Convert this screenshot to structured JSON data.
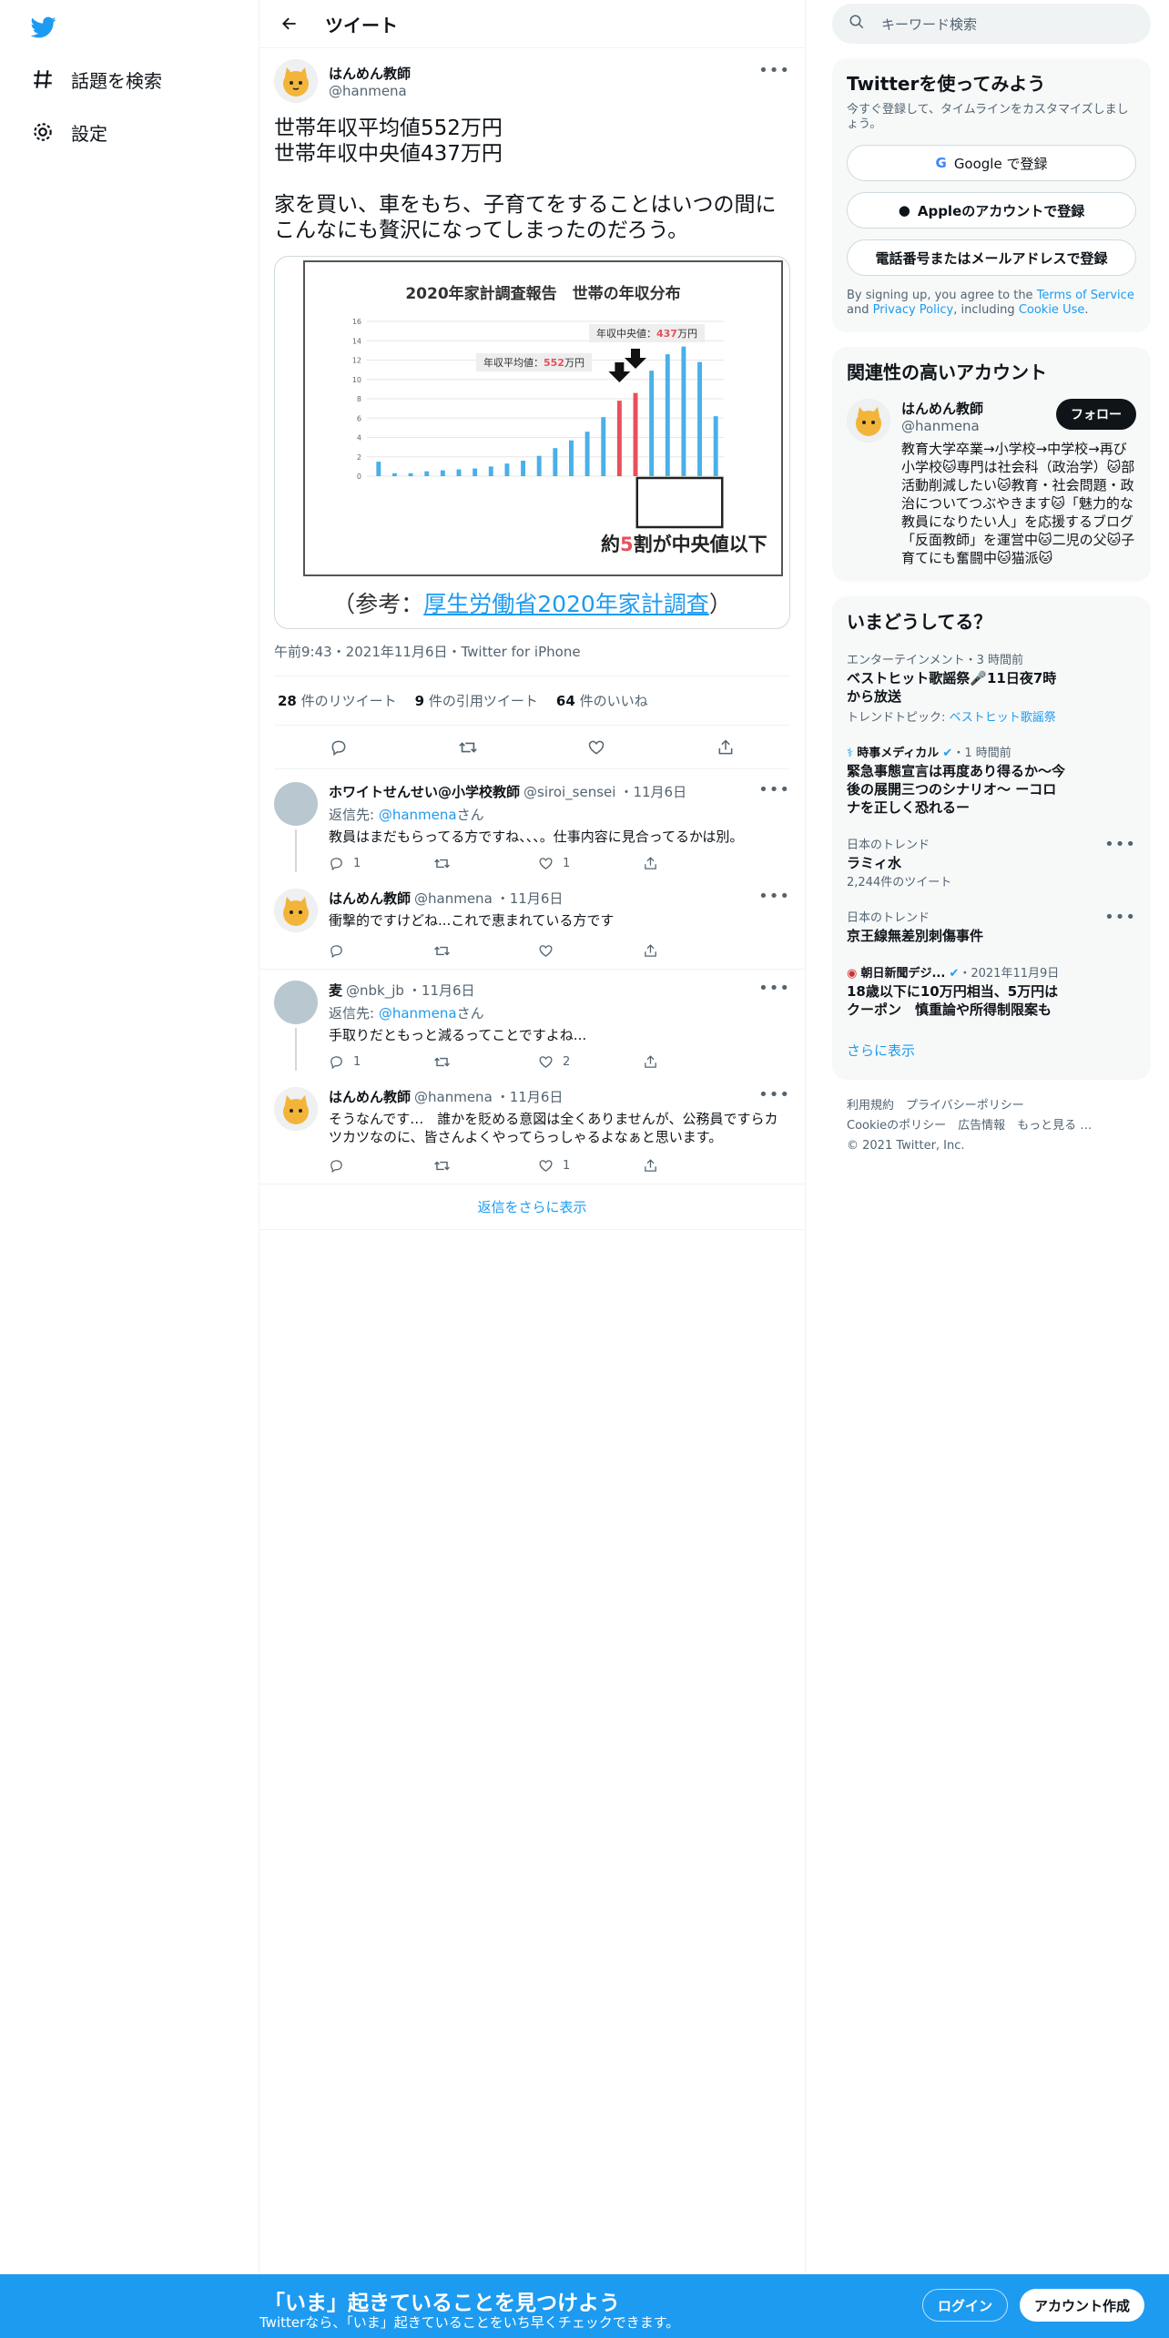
{
  "nav": {
    "items": [
      {
        "label": "話題を検索",
        "icon": "hashtag-icon"
      },
      {
        "label": "設定",
        "icon": "gear-icon"
      }
    ]
  },
  "header": {
    "title": "ツイート"
  },
  "tweet": {
    "name": "はんめん教師",
    "handle": "@hanmena",
    "text": "世帯年収平均値552万円\n世帯年収中央値437万円\n\n家を買い、車をもち、子育てをすることはいつの間にこんなにも贅沢になってしまったのだろう。",
    "media": {
      "chart_title": "2020年家計調査報告　世帯の年収分布",
      "median_label_prefix": "年収中央値：",
      "median_value": "437",
      "median_suffix": "万円",
      "mean_label_prefix": "年収平均値：",
      "mean_value": "552",
      "mean_suffix": "万円",
      "caption_prefix": "約",
      "caption_num": "5",
      "caption_suffix": "割が中央値以下",
      "ref_open": "（参考：",
      "ref_link": "厚生労働省2020年家計調査",
      "ref_close": "）"
    },
    "meta": "午前9:43・2021年11月6日・Twitter for iPhone",
    "stats": {
      "retweets_num": "28",
      "retweets_label": "件のリツイート",
      "quotes_num": "9",
      "quotes_label": "件の引用ツイート",
      "likes_num": "64",
      "likes_label": "件のいいね"
    }
  },
  "chart_data": {
    "type": "bar",
    "title": "2020年家計調査報告　世帯の年収分布",
    "ylim": [
      0,
      16
    ],
    "yticks": [
      0,
      2,
      4,
      6,
      8,
      10,
      12,
      14,
      16
    ],
    "values": [
      1.5,
      0.3,
      0.3,
      0.5,
      0.6,
      0.7,
      0.8,
      1.0,
      1.3,
      1.6,
      2.1,
      2.9,
      3.7,
      4.6,
      6.1,
      7.8,
      8.6,
      10.9,
      12.6,
      13.4,
      11.8,
      6.2
    ],
    "highlight": [
      15,
      16
    ]
  },
  "replies": [
    {
      "name": "ホワイトせんせい@小学校教師",
      "handle": "@siroi_sensei",
      "date": "・11月6日",
      "reply_to_prefix": "返信先: ",
      "reply_to": "@hanmena",
      "reply_to_suffix": "さん",
      "text": "教員はまだもらってる方ですね、、、。仕事内容に見合ってるかは別。",
      "reply_count": "1",
      "like_count": "1"
    },
    {
      "name": "はんめん教師",
      "handle": "@hanmena",
      "date": "・11月6日",
      "text": "衝撃的ですけどね...これで恵まれている方です"
    },
    {
      "name": "麦",
      "handle": "@nbk_jb",
      "date": "・11月6日",
      "reply_to_prefix": "返信先: ",
      "reply_to": "@hanmena",
      "reply_to_suffix": "さん",
      "text": "手取りだともっと減るってことですよね...",
      "reply_count": "1",
      "like_count": "2"
    },
    {
      "name": "はんめん教師",
      "handle": "@hanmena",
      "date": "・11月6日",
      "text": "そうなんです…　誰かを貶める意図は全くありませんが、公務員ですらカツカツなのに、皆さんよくやってらっしゃるよなぁと思います。",
      "like_count": "1"
    }
  ],
  "show_more_replies": "返信をさらに表示",
  "search": {
    "placeholder": "キーワード検索"
  },
  "signup": {
    "title": "Twitterを使ってみよう",
    "subtitle": "今すぐ登録して、タイムラインをカスタマイズしましょう。",
    "google": "Google で登録",
    "apple": "Appleのアカウントで登録",
    "phone": "電話番号またはメールアドレスで登録",
    "legal_1": "By signing up, you agree to the ",
    "terms": "Terms of Service",
    "legal_2": " and ",
    "privacy": "Privacy Policy",
    "legal_3": ", including ",
    "cookie": "Cookie Use",
    "legal_4": "."
  },
  "related": {
    "title": "関連性の高いアカウント",
    "name": "はんめん教師",
    "handle": "@hanmena",
    "follow": "フォロー",
    "bio": "教育大学卒業→小学校→中学校→再び小学校🐱専門は社会科（政治学）🐱部活動削減したい🐱教育・社会問題・政治についてつぶやきます🐱「魅力的な教員になりたい人」を応援するブログ「反面教師」を運営中🐱二児の父🐱子育てにも奮闘中🐱猫派🐱"
  },
  "trends": {
    "title": "いまどうしてる？",
    "items": [
      {
        "meta": "エンターテインメント・3 時間前",
        "title": "ベストヒット歌謡祭🎤11日夜7時から放送",
        "sub_prefix": "トレンドトピック: ",
        "sub_link": "ベストヒット歌謡祭"
      },
      {
        "meta": "時事メディカル",
        "meta_time": "・1 時間前",
        "title": "緊急事態宣言は再度あり得るか～今後の展開三つのシナリオ～ ーコロナを正しく恐れるー"
      },
      {
        "meta": "日本のトレンド",
        "title": "ラミィ水",
        "sub": "2,244件のツイート"
      },
      {
        "meta": "日本のトレンド",
        "title": "京王線無差別刺傷事件"
      },
      {
        "meta": "朝日新聞デジ...",
        "meta_time": "・2021年11月9日",
        "title": "18歳以下に10万円相当、5万円はクーポン　慎重論や所得制限案も"
      }
    ],
    "show_more": "さらに表示"
  },
  "footer": {
    "line1": "利用規約　プライバシーポリシー",
    "line2": "Cookieのポリシー　広告情報　もっと見る …",
    "line3": "© 2021 Twitter, Inc."
  },
  "bottom_bar": {
    "title": "「いま」起きていることを見つけよう",
    "subtitle": "Twitterなら、「いま」起きていることをいち早くチェックできます。",
    "login": "ログイン",
    "signup": "アカウント作成"
  },
  "colors": {
    "accent": "#1d9bf0",
    "bar_blue": "#4ab0e8",
    "bar_red": "#e8505b"
  }
}
